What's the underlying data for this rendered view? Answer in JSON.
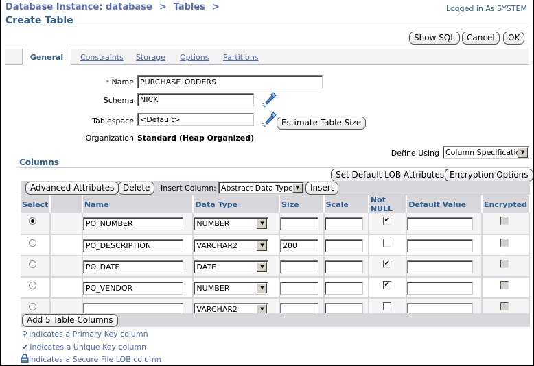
{
  "breadcrumb": {
    "items": [
      "Database Instance: database",
      "Tables"
    ],
    "separator": ">"
  },
  "page_title": "Create Table",
  "login_text": "Logged in As SYSTEM",
  "header_buttons": {
    "show_sql": "Show SQL",
    "cancel": "Cancel",
    "ok": "OK"
  },
  "tabs": [
    {
      "label": "General",
      "active": true
    },
    {
      "label": "Constraints",
      "active": false
    },
    {
      "label": "Storage",
      "active": false
    },
    {
      "label": "Options",
      "active": false
    },
    {
      "label": "Partitions",
      "active": false
    }
  ],
  "form": {
    "name_label": "Name",
    "required_marker": "*",
    "name_value": "PURCHASE_ORDERS",
    "schema_label": "Schema",
    "schema_value": "NICK",
    "tablespace_label": "Tablespace",
    "tablespace_value": "<Default>",
    "estimate_button": "Estimate Table Size",
    "organization_label": "Organization",
    "organization_value": "Standard (Heap Organized)",
    "define_using_label": "Define Using",
    "define_using_value": "Column Specification"
  },
  "columns_section": {
    "title": "Columns",
    "set_lob_button": "Set Default LOB Attributes",
    "encryption_button": "Encryption Options",
    "advanced_button": "Advanced Attributes",
    "delete_button": "Delete",
    "insert_column_label": "Insert Column:",
    "insert_type_value": "Abstract Data Type",
    "insert_button": "Insert",
    "headers": [
      "Select",
      "",
      "Name",
      "Data Type",
      "Size",
      "Scale",
      "Not NULL",
      "Default Value",
      "Encrypted"
    ],
    "rows": [
      {
        "selected": true,
        "name": "PO_NUMBER",
        "data_type": "NUMBER",
        "size": "",
        "scale": "",
        "not_null": true,
        "default": "",
        "encrypted": false
      },
      {
        "selected": false,
        "name": "PO_DESCRIPTION",
        "data_type": "VARCHAR2",
        "size": "200",
        "scale": "",
        "not_null": false,
        "default": "",
        "encrypted": false
      },
      {
        "selected": false,
        "name": "PO_DATE",
        "data_type": "DATE",
        "size": "",
        "scale": "",
        "not_null": true,
        "default": "",
        "encrypted": false
      },
      {
        "selected": false,
        "name": "PO_VENDOR",
        "data_type": "NUMBER",
        "size": "",
        "scale": "",
        "not_null": true,
        "default": "",
        "encrypted": false
      },
      {
        "selected": false,
        "name": "",
        "data_type": "VARCHAR2",
        "size": "",
        "scale": "",
        "not_null": false,
        "default": "",
        "encrypted": false
      }
    ],
    "add_columns_button": "Add 5 Table Columns"
  },
  "legend": [
    {
      "icon": "key-icon",
      "text": "Indicates a Primary Key column"
    },
    {
      "icon": "checkmark-icon",
      "text": "Indicates a Unique Key column"
    },
    {
      "icon": "lock-icon",
      "text": "Indicates a Secure File LOB column"
    }
  ]
}
